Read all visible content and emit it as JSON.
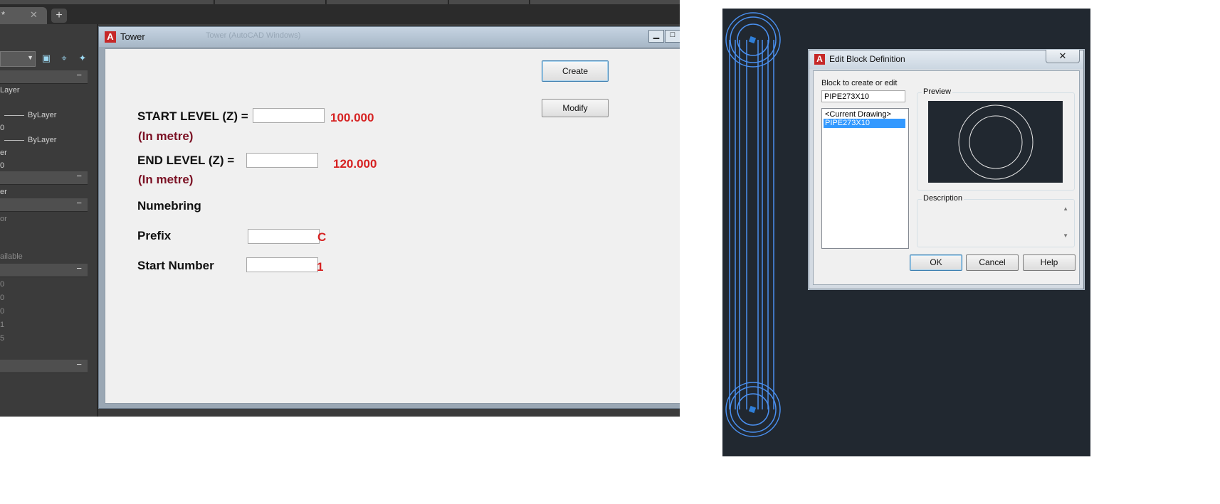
{
  "left_app": {
    "document_tab": {
      "marker": "*",
      "close_glyph": "✕"
    },
    "new_tab_glyph": "+",
    "palette": {
      "section_collapse_glyph": "−",
      "rows": [
        "Layer",
        "ByLayer",
        "0",
        "ByLayer",
        "er",
        "0",
        "er",
        "or",
        "ailable",
        "0",
        "0",
        "0",
        "1",
        "5"
      ]
    }
  },
  "tower_window": {
    "title": "Tower",
    "blurred_title_text": "Tower (AutoCAD Windows)",
    "min_glyph": "▁",
    "max_glyph": "□",
    "start_level": {
      "label": "START LEVEL (Z) =",
      "unit": "(In metre)",
      "value": "100.000"
    },
    "end_level": {
      "label": "END LEVEL (Z) =",
      "unit": "(In metre)",
      "value": "120.000"
    },
    "numbering_heading": "Numebring",
    "prefix": {
      "label": "Prefix",
      "value": "C"
    },
    "start_number": {
      "label": "Start Number",
      "value": "1"
    },
    "create_button": "Create",
    "modify_button": "Modify"
  },
  "edit_block_dialog": {
    "title": "Edit Block Definition",
    "close_glyph": "✕",
    "block_label": "Block to create or edit",
    "block_value": "PIPE273X10",
    "list_items": [
      "<Current Drawing>",
      "PIPE273X10"
    ],
    "selected_index": 1,
    "preview_label": "Preview",
    "description_label": "Description",
    "ok_button": "OK",
    "cancel_button": "Cancel",
    "help_button": "Help"
  },
  "colors": {
    "accent_value": "#d62222",
    "unit_text": "#7b1124",
    "drawing_bg": "#212830",
    "pipe_line": "#4a90f0",
    "selection": "#3399ff"
  }
}
